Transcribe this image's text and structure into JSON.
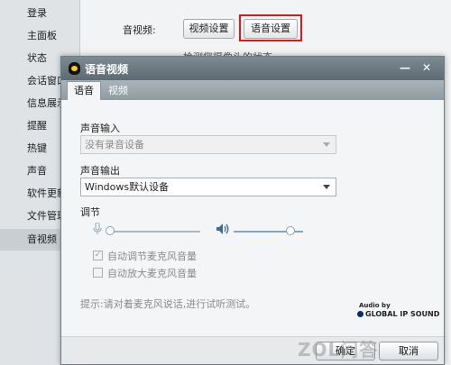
{
  "sidebar": {
    "items": [
      {
        "label": "登录"
      },
      {
        "label": "主面板"
      },
      {
        "label": "状态"
      },
      {
        "label": "会话窗口"
      },
      {
        "label": "信息展示"
      },
      {
        "label": "提醒"
      },
      {
        "label": "热键"
      },
      {
        "label": "声音"
      },
      {
        "label": "软件更新"
      },
      {
        "label": "文件管理"
      },
      {
        "label": "音视频"
      }
    ]
  },
  "background": {
    "section_label": "音视频:",
    "video_settings_button": "视频设置",
    "voice_settings_button": "语音设置",
    "partial_text": "检测您摄像头的状态"
  },
  "dialog": {
    "title": "语音视频",
    "minimize_glyph": "—",
    "close_glyph": "✕",
    "tabs": [
      {
        "label": "语音",
        "active": true
      },
      {
        "label": "视频",
        "active": false
      }
    ],
    "input_label": "声音输入",
    "input_device": "没有录音设备",
    "output_label": "声音输出",
    "output_device": "Windows默认设备",
    "adjust_label": "调节",
    "mic_level": 0.0,
    "speaker_level": 0.82,
    "auto_adjust_mic": {
      "label": "自动调节麦克风音量",
      "checked": true
    },
    "auto_amplify_mic": {
      "label": "自动放大麦克风音量",
      "checked": false
    },
    "hint": "提示:请对着麦克风说话,进行试听测试。",
    "audio_by": "Audio by",
    "gips_logo": "GLOBAL IP SOUND",
    "ok_button": "确定",
    "cancel_button": "取消"
  },
  "watermark": "ZOL问答",
  "colors": {
    "highlight_box": "#e01818",
    "titlebar": "#6b7881"
  }
}
